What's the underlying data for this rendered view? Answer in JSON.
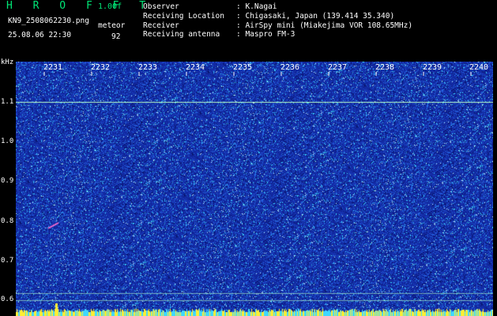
{
  "header": {
    "brand": "H R O F F T",
    "version": "1.00f",
    "filename": "KN9_2508062230.png",
    "datetime": "25.08.06 22:30",
    "meteor_label": "meteor",
    "meteor_count": "92"
  },
  "info": [
    {
      "key": "Observer",
      "value": ": K.Nagai"
    },
    {
      "key": "Receiving Location",
      "value": ": Chigasaki, Japan (139.414 35.340)"
    },
    {
      "key": "Receiver",
      "value": ": AirSpy mini (Miakejima VOR 108.65MHz)"
    },
    {
      "key": "Receiving antenna",
      "value": ": Maspro FM-3"
    }
  ],
  "axis": {
    "y_unit": "kHz",
    "y_labels": [
      "1.1",
      "1.0",
      "0.9",
      "0.8",
      "0.7",
      "0.6"
    ],
    "x_labels": [
      "2231",
      "2232",
      "2233",
      "2234",
      "2235",
      "2236",
      "2237",
      "2238",
      "2239",
      "2240"
    ]
  },
  "colors": {
    "background": "#1530a8",
    "noise_bright": "#4ff0ff",
    "carrier_line": "#b8ffc8",
    "meteor_echo": "#ff66cc",
    "bottom_strip": "#ffee33"
  }
}
